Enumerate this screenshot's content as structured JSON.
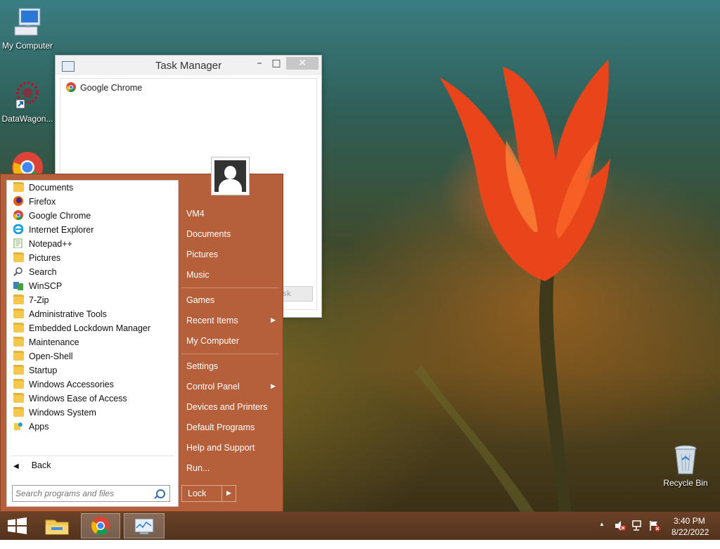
{
  "desktop": {
    "icons": [
      {
        "label": "My Computer",
        "icon": "computer-icon"
      },
      {
        "label": "DataWagon...",
        "icon": "datawagon-icon"
      },
      {
        "label": "",
        "icon": "chrome-icon"
      },
      {
        "label": "Recycle Bin",
        "icon": "recycle-bin-icon"
      }
    ]
  },
  "task_manager": {
    "title": "Task Manager",
    "minimize": "–",
    "maximize": "□",
    "close": "✕",
    "processes": [
      "Google Chrome"
    ],
    "end_task_label": "sk"
  },
  "start_menu": {
    "programs": [
      {
        "label": "Documents",
        "icon": "documents-icon"
      },
      {
        "label": "Firefox",
        "icon": "firefox-icon"
      },
      {
        "label": "Google Chrome",
        "icon": "chrome-icon"
      },
      {
        "label": "Internet Explorer",
        "icon": "internet-explorer-icon"
      },
      {
        "label": "Notepad++",
        "icon": "notepadpp-icon"
      },
      {
        "label": "Pictures",
        "icon": "pictures-icon"
      },
      {
        "label": "Search",
        "icon": "search-icon"
      },
      {
        "label": "WinSCP",
        "icon": "winscp-icon"
      },
      {
        "label": "7-Zip",
        "icon": "folder-icon"
      },
      {
        "label": "Administrative Tools",
        "icon": "folder-icon"
      },
      {
        "label": "Embedded Lockdown Manager",
        "icon": "folder-icon"
      },
      {
        "label": "Maintenance",
        "icon": "folder-icon"
      },
      {
        "label": "Open-Shell",
        "icon": "folder-icon"
      },
      {
        "label": "Startup",
        "icon": "folder-icon"
      },
      {
        "label": "Windows Accessories",
        "icon": "folder-icon"
      },
      {
        "label": "Windows Ease of Access",
        "icon": "folder-icon"
      },
      {
        "label": "Windows System",
        "icon": "folder-icon"
      },
      {
        "label": "Apps",
        "icon": "apps-icon"
      }
    ],
    "back_label": "Back",
    "back_arrow": "◀",
    "search_placeholder": "Search programs and files",
    "right_group1": [
      "VM4",
      "Documents",
      "Pictures",
      "Music"
    ],
    "right_group2": [
      "Games",
      "Recent Items",
      "My Computer"
    ],
    "right_group3": [
      "Settings",
      "Control Panel",
      "Devices and Printers",
      "Default Programs",
      "Help and Support",
      "Run..."
    ],
    "submenu_arrow": "▶",
    "lock_label": "Lock",
    "lock_arrow": "▶"
  },
  "taskbar": {
    "pinned": [
      "start-icon",
      "file-explorer-icon",
      "chrome-icon",
      "task-manager-icon"
    ],
    "tray_up_arrow": "▲",
    "time": "3:40 PM",
    "date": "8/22/2022"
  }
}
